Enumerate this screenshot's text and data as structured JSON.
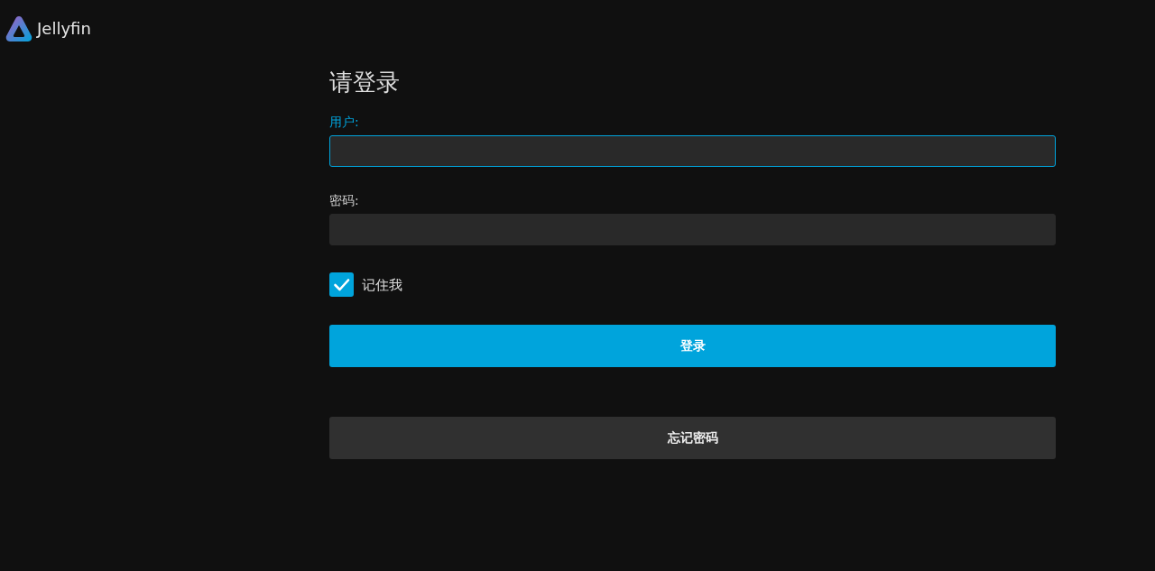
{
  "header": {
    "app_name": "Jellyfin"
  },
  "form": {
    "title": "请登录",
    "fields": [
      {
        "label": "用户:",
        "focused": true
      },
      {
        "label": "密码:",
        "focused": false
      }
    ],
    "remember": {
      "label": "记住我",
      "checked": true
    },
    "buttons": [
      {
        "label": "登录",
        "kind": "primary"
      },
      {
        "label": "忘记密码",
        "kind": "secondary"
      }
    ]
  }
}
